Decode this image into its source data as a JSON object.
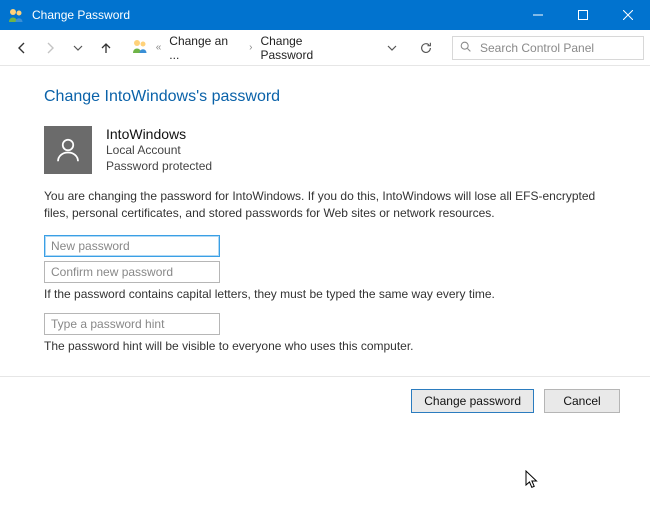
{
  "titlebar": {
    "title": "Change Password"
  },
  "nav": {
    "segment1": "Change an ...",
    "segment2": "Change Password",
    "search_placeholder": "Search Control Panel"
  },
  "page": {
    "heading": "Change IntoWindows's password",
    "user": {
      "name": "IntoWindows",
      "type": "Local Account",
      "status": "Password protected"
    },
    "explain": "You are changing the password for IntoWindows.  If you do this, IntoWindows will lose all EFS-encrypted files, personal certificates, and stored passwords for Web sites or network resources.",
    "new_password_placeholder": "New password",
    "confirm_password_placeholder": "Confirm new password",
    "caps_helper": "If the password contains capital letters, they must be typed the same way every time.",
    "hint_placeholder": "Type a password hint",
    "hint_helper": "The password hint will be visible to everyone who uses this computer."
  },
  "footer": {
    "change_label": "Change password",
    "cancel_label": "Cancel"
  }
}
